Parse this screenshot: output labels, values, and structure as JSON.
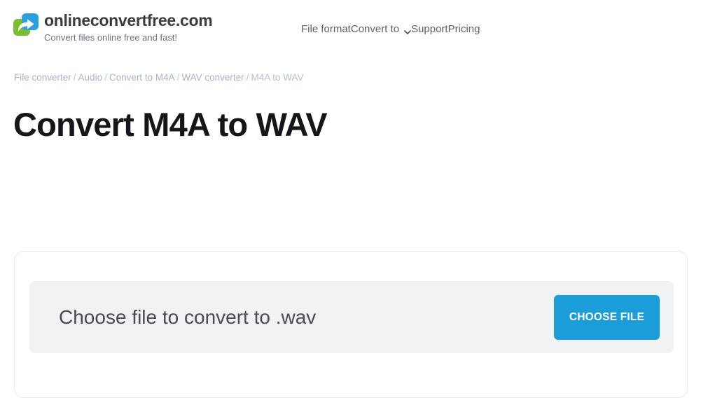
{
  "header": {
    "brand": {
      "logo_icon": "convert-arrow-logo-icon",
      "name": "onlineconvertfree.com",
      "tagline": "Convert files online free and fast!",
      "colors": {
        "green": "#7CBF2E",
        "blue": "#2C9FDE"
      }
    },
    "nav": [
      {
        "label": "File format",
        "has_chevron": false
      },
      {
        "label": "Convert to",
        "has_chevron": true,
        "chevron_icon": "chevron-down-icon"
      },
      {
        "label": "Support",
        "has_chevron": false
      },
      {
        "label": "Pricing",
        "has_chevron": false
      }
    ]
  },
  "breadcrumb": {
    "separator": "/",
    "items": [
      {
        "label": "File converter",
        "current": false
      },
      {
        "label": "Audio",
        "current": false
      },
      {
        "label": "Convert to M4A",
        "current": false
      },
      {
        "label": "WAV converter",
        "current": false
      },
      {
        "label": "M4A to WAV",
        "current": true
      }
    ]
  },
  "main": {
    "title": "Convert M4A to WAV",
    "converter": {
      "dropzone_label": "Choose file to convert to .wav",
      "choose_file_label": "CHOOSE FILE",
      "accent_color": "#1b9dd9",
      "dropzone_background": "#f1f2f4"
    }
  }
}
